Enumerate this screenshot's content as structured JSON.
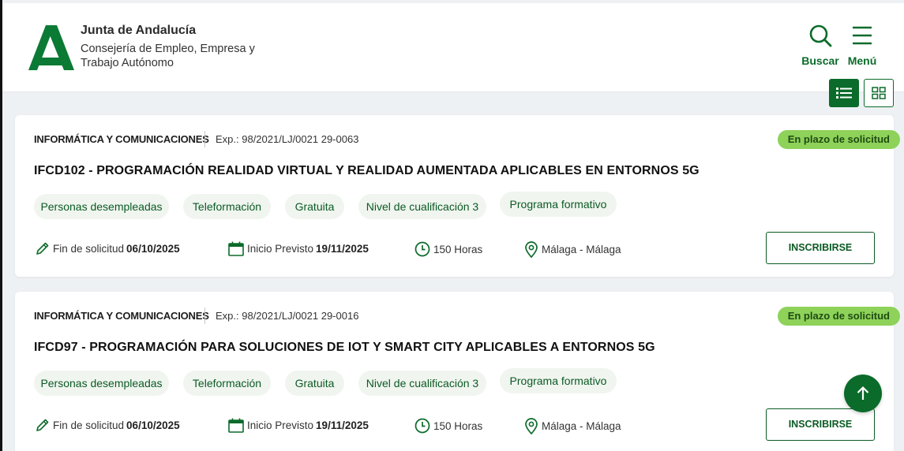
{
  "header": {
    "title": "Junta de Andalucía",
    "subtitle": "Consejería de Empleo, Empresa y Trabajo Autónomo",
    "search_label": "Buscar",
    "menu_label": "Menú"
  },
  "colors": {
    "brand_green": "#0b6b2a",
    "status_bg": "#8ed25a",
    "tag_bg": "#f0f5ef"
  },
  "courses": [
    {
      "category": "INFORMÁTICA Y COMUNICACIONES",
      "expediente": "Exp.: 98/2021/LJ/0021 29-0063",
      "status": "En plazo de solicitud",
      "title": "IFCD102 - PROGRAMACIÓN REALIDAD VIRTUAL Y REALIDAD AUMENTADA APLICABLES EN ENTORNOS 5G",
      "tags": [
        "Personas desempleadas",
        "Teleformación",
        "Gratuita",
        "Nivel de cualificación 3",
        "Programa formativo"
      ],
      "deadline_label": "Fin de solicitud",
      "deadline": "06/10/2025",
      "start_label": "Inicio Previsto",
      "start": "19/11/2025",
      "hours": "150 Horas",
      "location": "Málaga - Málaga",
      "cta": "INSCRIBIRSE"
    },
    {
      "category": "INFORMÁTICA Y COMUNICACIONES",
      "expediente": "Exp.: 98/2021/LJ/0021 29-0016",
      "status": "En plazo de solicitud",
      "title": "IFCD97 - PROGRAMACIÓN PARA SOLUCIONES DE IOT Y SMART CITY APLICABLES A ENTORNOS 5G",
      "tags": [
        "Personas desempleadas",
        "Teleformación",
        "Gratuita",
        "Nivel de cualificación 3",
        "Programa formativo"
      ],
      "deadline_label": "Fin de solicitud",
      "deadline": "06/10/2025",
      "start_label": "Inicio Previsto",
      "start": "19/11/2025",
      "hours": "150 Horas",
      "location": "Málaga - Málaga",
      "cta": "INSCRIBIRSE"
    }
  ],
  "icons": [
    "junta-logo-icon",
    "search-icon",
    "hamburger-menu-icon",
    "list-view-icon",
    "grid-view-icon",
    "pencil-icon",
    "calendar-icon",
    "clock-icon",
    "location-pin-icon",
    "arrow-up-icon"
  ]
}
